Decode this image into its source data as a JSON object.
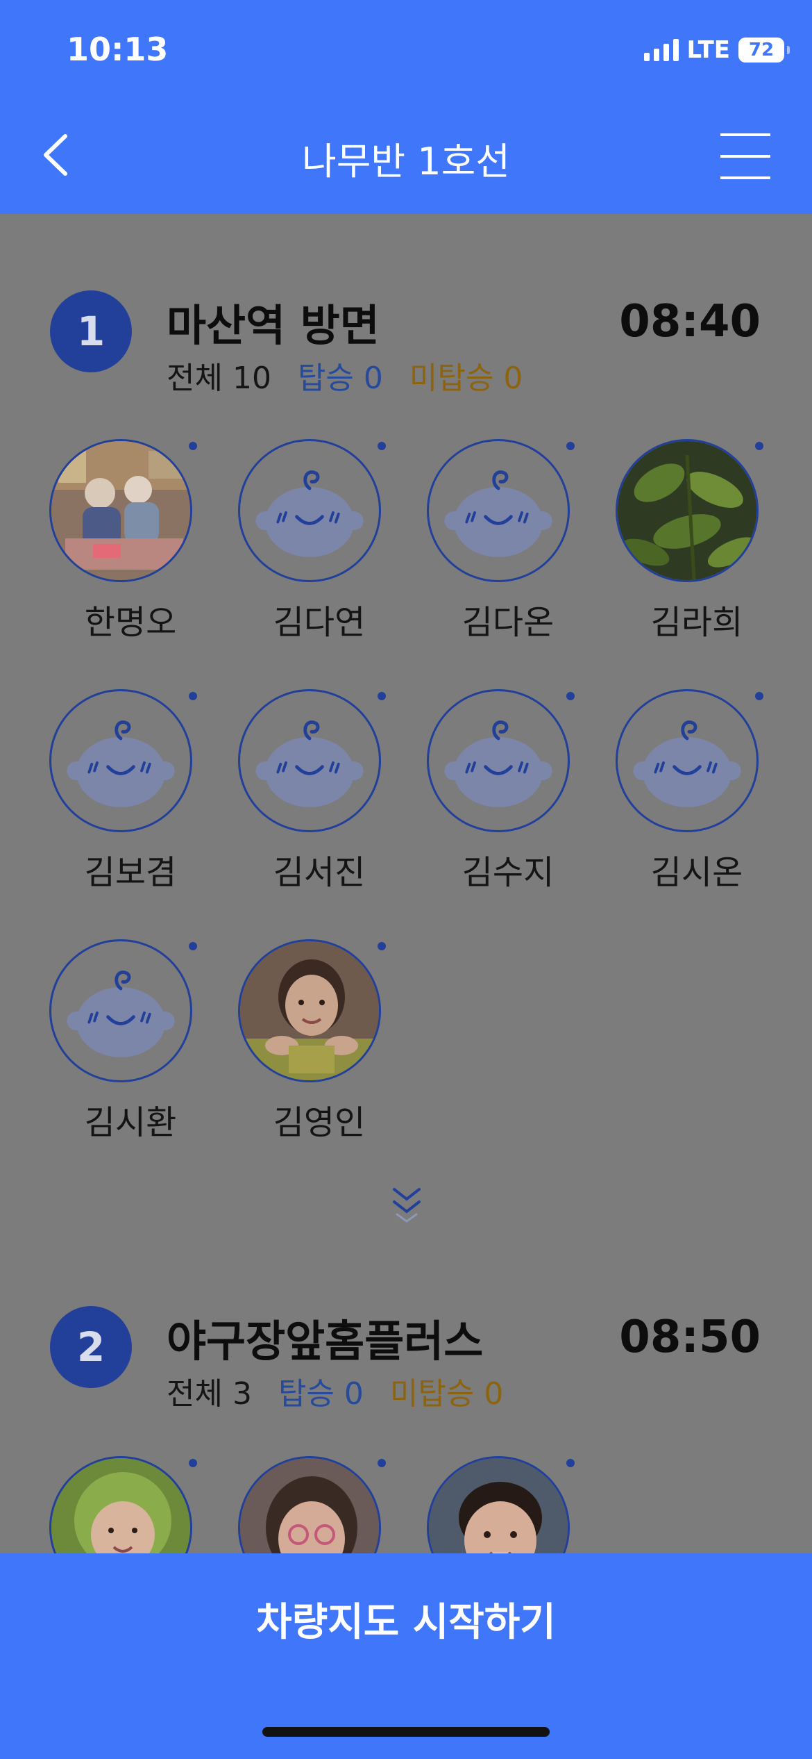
{
  "status_bar": {
    "time": "10:13",
    "network": "LTE",
    "battery": "72"
  },
  "header": {
    "title": "나무반 1호선"
  },
  "stops": [
    {
      "number": "1",
      "name": "마산역 방면",
      "time": "08:40",
      "total": "전체 10",
      "boarded": "탑승 0",
      "not_boarded": "미탑승 0",
      "children": [
        {
          "name": "한명오",
          "avatar": "photo-classroom"
        },
        {
          "name": "김다연",
          "avatar": "default-baby-icon"
        },
        {
          "name": "김다온",
          "avatar": "default-baby-icon"
        },
        {
          "name": "김라희",
          "avatar": "photo-plant"
        },
        {
          "name": "김보겸",
          "avatar": "default-baby-icon"
        },
        {
          "name": "김서진",
          "avatar": "default-baby-icon"
        },
        {
          "name": "김수지",
          "avatar": "default-baby-icon"
        },
        {
          "name": "김시온",
          "avatar": "default-baby-icon"
        },
        {
          "name": "김시환",
          "avatar": "default-baby-icon"
        },
        {
          "name": "김영인",
          "avatar": "photo-girl"
        }
      ]
    },
    {
      "number": "2",
      "name": "야구장앞홈플러스",
      "time": "08:50",
      "total": "전체 3",
      "boarded": "탑승 0",
      "not_boarded": "미탑승 0",
      "children": [
        {
          "name": "",
          "avatar": "photo-child-green-hood"
        },
        {
          "name": "",
          "avatar": "photo-child-glasses"
        },
        {
          "name": "",
          "avatar": "photo-child-boy"
        }
      ]
    }
  ],
  "bottom_button": {
    "label": "차량지도 시작하기"
  },
  "colors": {
    "primary": "#4076fa",
    "navy": "#22409a",
    "boarded": "#264a9c",
    "not_boarded": "#8c6410",
    "overlay_bg": "#7c7c7c"
  }
}
